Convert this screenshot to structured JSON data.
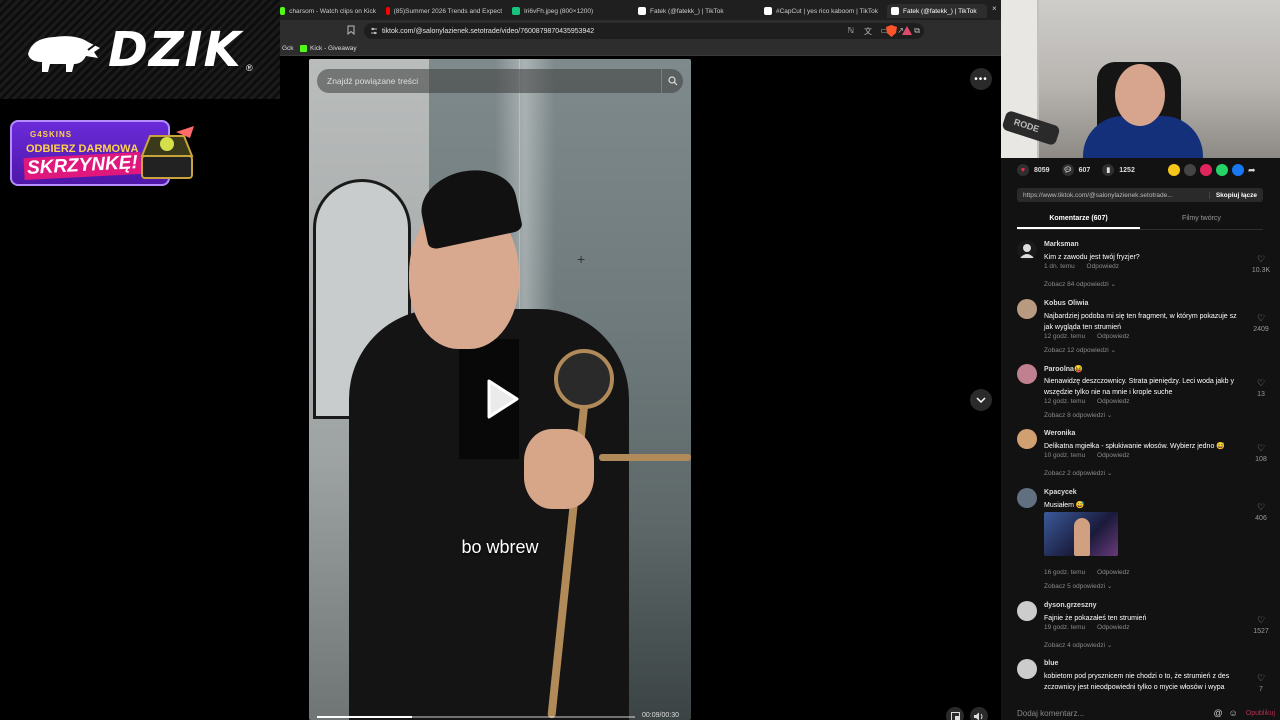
{
  "overlay": {
    "logo_text": "DZIK",
    "logo_reg": "®",
    "promo": {
      "brand": "G4SKINS",
      "line1": "ODBIERZ DARMOWĄ",
      "line2": "SKRZYNKĘ!"
    }
  },
  "browser": {
    "tabs": [
      {
        "label": "charsom - Watch clips on Kick",
        "color": "#53fc18"
      },
      {
        "label": "(85)Summer 2026 Trends and Expect",
        "color": "#ff0000"
      },
      {
        "label": "Iri6vFh.jpeg (800×1200)",
        "color": "#18c37d"
      },
      {
        "label": "Fatek (@fatekk_) | TikTok",
        "color": "#ffffff"
      },
      {
        "label": "#CapCut | yes rico kaboom | TikTok",
        "color": "#ffffff"
      },
      {
        "label": "Fatek (@fatekk_) | TikTok",
        "color": "#ffffff",
        "active": true
      }
    ],
    "tab_close": "×",
    "url": "tiktok.com/@salonylazienek.setotrade/video/7600879870435953942",
    "bookmarks": [
      {
        "label": "Gck"
      },
      {
        "label": "Kick - Giveaway"
      }
    ]
  },
  "video": {
    "search_placeholder": "Znajdź powiązane treści",
    "caption": "bo wbrew",
    "time": "00:09/00:30",
    "progress": 0.3,
    "more": "•••"
  },
  "side": {
    "stats": {
      "likes": "8059",
      "comments": "607",
      "saves": "1252"
    },
    "share_colors": [
      "#f5c518",
      "#444444",
      "#e0245e",
      "#25d366",
      "#1877f2"
    ],
    "link": "https://www.tiktok.com/@salonylazienek.setotrade...",
    "copy_label": "Skopiuj łącze",
    "tab_comments": "Komentarze (607)",
    "tab_creator": "Filmy twórcy",
    "reply_label": "Odpowiedz",
    "comments": [
      {
        "user": "Marksman",
        "text": "Kim z zawodu jest twój fryzjer?",
        "time": "1 dn. temu",
        "replies": "Zobacz 84 odpowiedzi ⌄",
        "likes": "10.3K",
        "avatar": "#1a1a1a"
      },
      {
        "user": "Kobus Oliwia",
        "text": "Najbardziej podoba mi się ten fragment, w którym pokazuje sz jak wygląda ten strumień",
        "time": "12 godz. temu",
        "replies": "Zobacz 12 odpowiedzi ⌄",
        "likes": "2409",
        "avatar": "#b89a80"
      },
      {
        "user": "Paroolna😝",
        "text": "Nienawidzę deszczownicy. Strata pieniędzy. Leci woda jakb y wszędzie tylko nie na mnie i krople suche",
        "time": "12 godz. temu",
        "replies": "Zobacz 8 odpowiedzi ⌄",
        "likes": "13",
        "avatar": "#c08090"
      },
      {
        "user": "Weronika",
        "text": "Delikatna mgiełka - spłukiwanie włosów. Wybierz jedno 😅",
        "time": "10 godz. temu",
        "replies": "Zobacz 2 odpowiedzi ⌄",
        "likes": "108",
        "avatar": "#d0a070"
      },
      {
        "user": "Kpacycek",
        "text": "Musiałem 😅",
        "time": "16 godz. temu",
        "replies": "Zobacz 5 odpowiedzi ⌄",
        "likes": "406",
        "avatar": "#607080"
      },
      {
        "user": "dyson.grzeszny",
        "text": "Fajnie że pokazałeś ten strumień",
        "time": "19 godz. temu",
        "replies": "Zobacz 4 odpowiedzi ⌄",
        "likes": "1527",
        "avatar": "#cccccc"
      },
      {
        "user": "blue",
        "text": "kobietom pod prysznicem nie chodzi o to, że strumień z des zczownicy jest nieodpowiedni tylko o mycie włosów i wypa",
        "time": "",
        "replies": "",
        "likes": "7",
        "avatar": "#cccccc"
      }
    ],
    "comment_input_placeholder": "Dodaj komentarz...",
    "post_label": "Opublikuj"
  },
  "webcam": {
    "mic_label": "RODE"
  }
}
